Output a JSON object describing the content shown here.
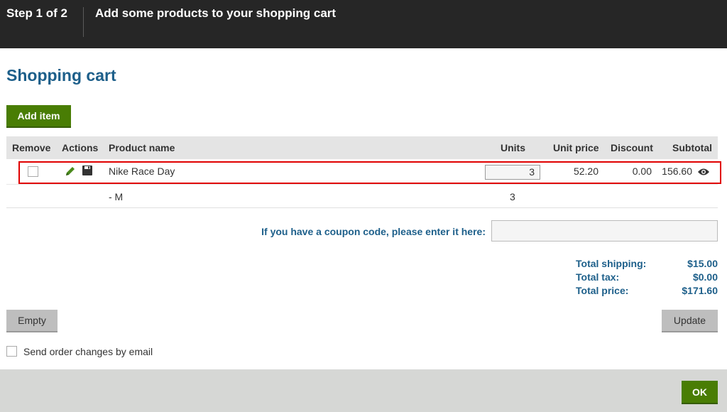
{
  "header": {
    "step": "Step 1 of 2",
    "title": "Add some products to your shopping cart"
  },
  "page": {
    "heading": "Shopping cart",
    "add_item_label": "Add item"
  },
  "table": {
    "columns": {
      "remove": "Remove",
      "actions": "Actions",
      "product_name": "Product name",
      "units": "Units",
      "unit_price": "Unit price",
      "discount": "Discount",
      "subtotal": "Subtotal"
    },
    "rows": [
      {
        "remove_checked": false,
        "product_name": "Nike Race Day",
        "units": "3",
        "unit_price": "52.20",
        "discount": "0.00",
        "subtotal": "156.60"
      }
    ],
    "variant": {
      "name": "- M",
      "units": "3"
    }
  },
  "coupon": {
    "label": "If you have a coupon code, please enter it here:",
    "value": ""
  },
  "totals": {
    "shipping_label": "Total shipping:",
    "shipping_value": "$15.00",
    "tax_label": "Total tax:",
    "tax_value": "$0.00",
    "price_label": "Total price:",
    "price_value": "$171.60"
  },
  "actions": {
    "empty_label": "Empty",
    "update_label": "Update",
    "send_email_label": "Send order changes by email",
    "send_email_checked": false,
    "ok_label": "OK"
  },
  "colors": {
    "header_bg": "#262626",
    "heading": "#1d5f8a",
    "primary_button": "#497d04",
    "secondary_button": "#bebebe",
    "highlight_border": "#e00000",
    "footer_bg": "#d6d7d5"
  },
  "icons": {
    "edit": "pencil-icon",
    "save": "save-disk-icon",
    "preview": "eye-icon"
  }
}
